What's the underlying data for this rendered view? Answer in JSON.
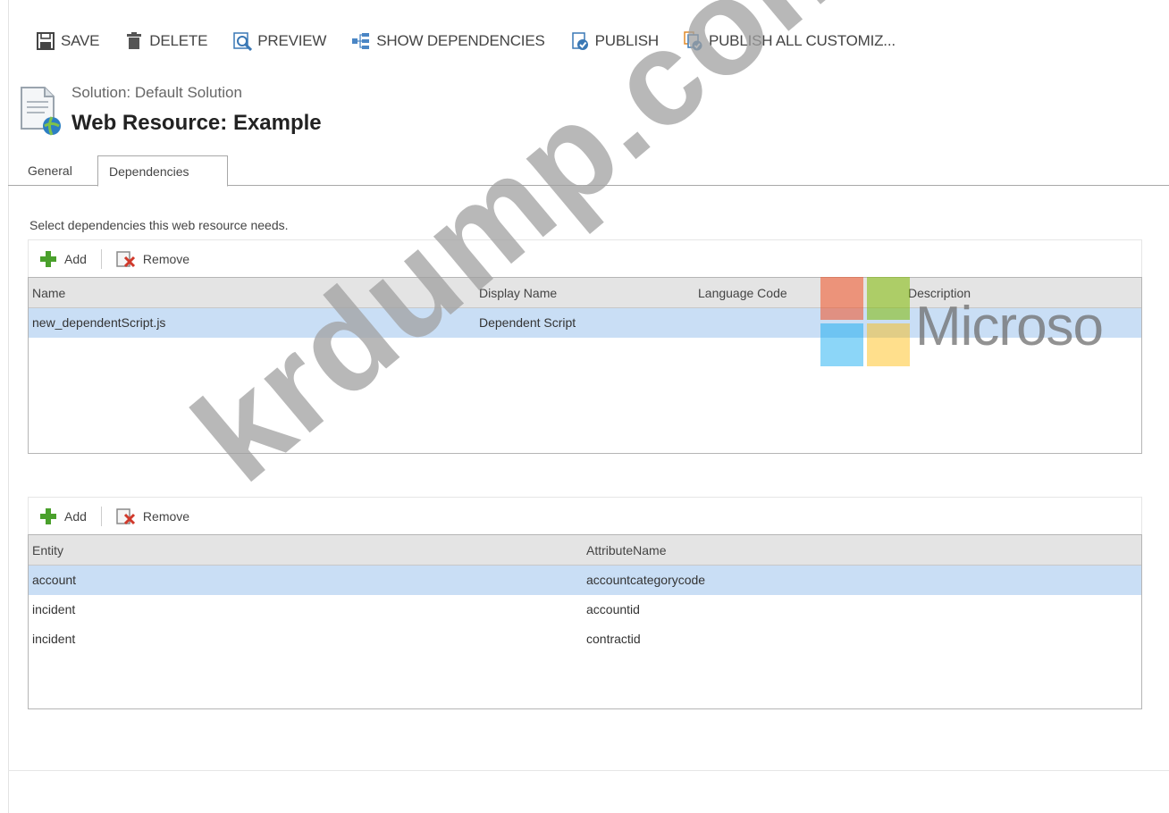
{
  "toolbar": {
    "save": "SAVE",
    "delete": "DELETE",
    "preview": "PREVIEW",
    "show_dependencies": "SHOW DEPENDENCIES",
    "publish": "PUBLISH",
    "publish_all": "PUBLISH ALL CUSTOMIZ..."
  },
  "header": {
    "solution": "Solution: Default Solution",
    "title": "Web Resource: Example"
  },
  "tabs": [
    {
      "label": "General"
    },
    {
      "label": "Dependencies"
    }
  ],
  "instruction": "Select dependencies this web resource needs.",
  "web_resources_grid": {
    "add_label": "Add",
    "remove_label": "Remove",
    "columns": [
      "Name",
      "Display Name",
      "Language Code",
      "Description"
    ],
    "rows": [
      {
        "name": "new_dependentScript.js",
        "display_name": "Dependent Script",
        "language_code": "",
        "description": ""
      }
    ]
  },
  "attributes_grid": {
    "add_label": "Add",
    "remove_label": "Remove",
    "columns": [
      "Entity",
      "AttributeName"
    ],
    "rows": [
      {
        "entity": "account",
        "attribute": "accountcategorycode"
      },
      {
        "entity": "incident",
        "attribute": "accountid"
      },
      {
        "entity": "incident",
        "attribute": "contractid"
      }
    ]
  },
  "watermark": {
    "text": "krdump.com",
    "logo_text": "Microso"
  },
  "colors": {
    "selected_row": "#c9def5",
    "header_bg": "#e4e4e4",
    "ms_red": "#f25022",
    "ms_green": "#7fba00",
    "ms_blue": "#00a4ef",
    "ms_yellow": "#ffb900"
  }
}
